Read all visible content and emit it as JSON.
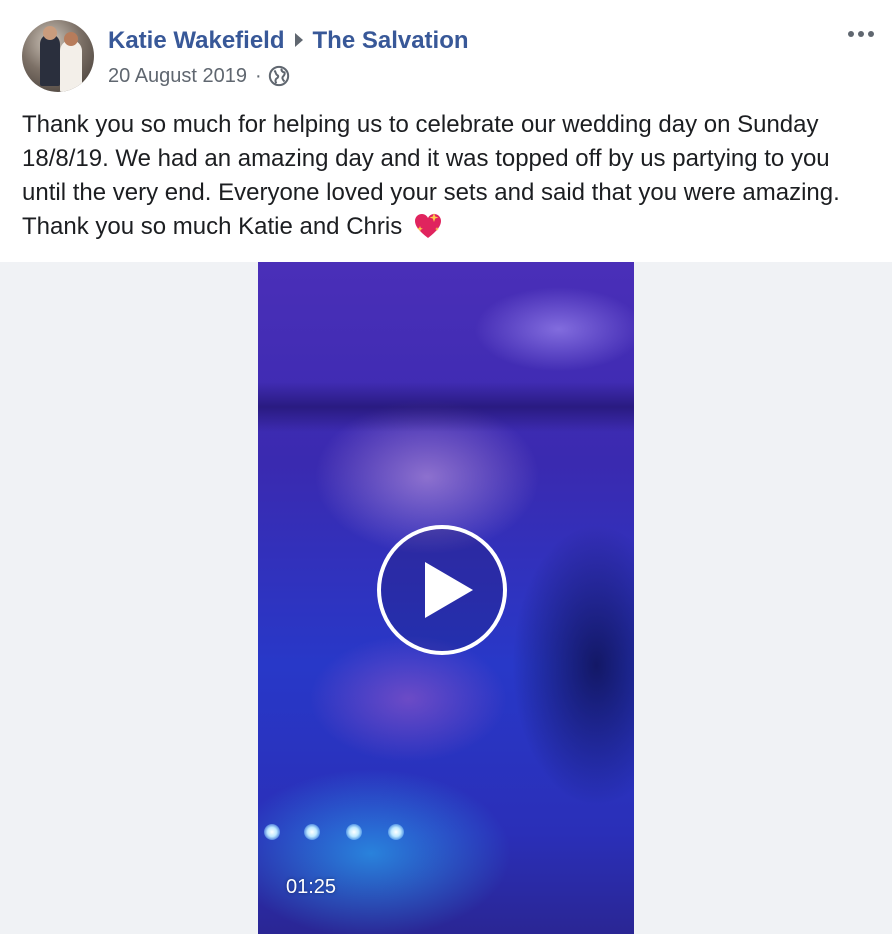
{
  "post": {
    "author": "Katie Wakefield",
    "target_page": "The Salvation",
    "date": "20 August 2019",
    "separator": "·",
    "privacy_icon": "globe-icon",
    "more_icon": "more-options-icon",
    "text": "Thank you so much for helping us to celebrate our wedding day on Sunday 18/8/19. We had an amazing day and it was topped off by us partying to you until the very end. Everyone loved your sets and said that you were amazing. Thank you so much Katie and Chris",
    "emoji": "sparkling-heart-icon"
  },
  "video": {
    "duration": "01:25",
    "play_icon": "play-icon"
  },
  "colors": {
    "link": "#385898",
    "secondary_text": "#606770",
    "body_text": "#1c1e21",
    "media_background": "#f0f2f5"
  }
}
